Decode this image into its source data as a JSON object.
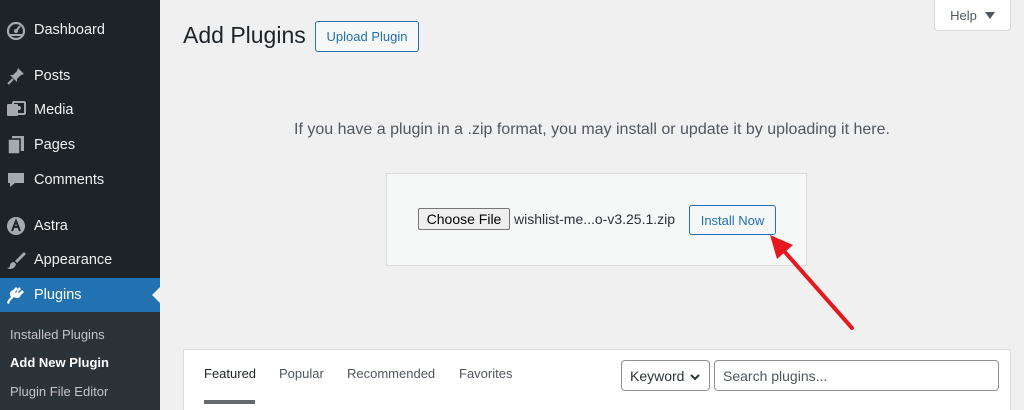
{
  "sidebar": {
    "items": [
      {
        "label": "Dashboard",
        "icon": "dashboard-icon"
      },
      {
        "label": "Posts",
        "icon": "pin-icon"
      },
      {
        "label": "Media",
        "icon": "media-icon"
      },
      {
        "label": "Pages",
        "icon": "pages-icon"
      },
      {
        "label": "Comments",
        "icon": "comment-icon"
      },
      {
        "label": "Astra",
        "icon": "astra-icon"
      },
      {
        "label": "Appearance",
        "icon": "brush-icon"
      },
      {
        "label": "Plugins",
        "icon": "plugin-icon"
      }
    ],
    "submenu": [
      "Installed Plugins",
      "Add New Plugin",
      "Plugin File Editor"
    ]
  },
  "header": {
    "title": "Add Plugins",
    "upload_button": "Upload Plugin",
    "help": "Help"
  },
  "upload": {
    "instruction": "If you have a plugin in a .zip format, you may install or update it by uploading it here.",
    "choose_file": "Choose File",
    "file_name": "wishlist-me...o-v3.25.1.zip",
    "install_button": "Install Now"
  },
  "filter": {
    "tabs": [
      "Featured",
      "Popular",
      "Recommended",
      "Favorites"
    ],
    "select_value": "Keyword",
    "search_placeholder": "Search plugins..."
  },
  "colors": {
    "sidebar_bg": "#1d2327",
    "accent": "#2271b1",
    "arrow": "#e5181f"
  }
}
